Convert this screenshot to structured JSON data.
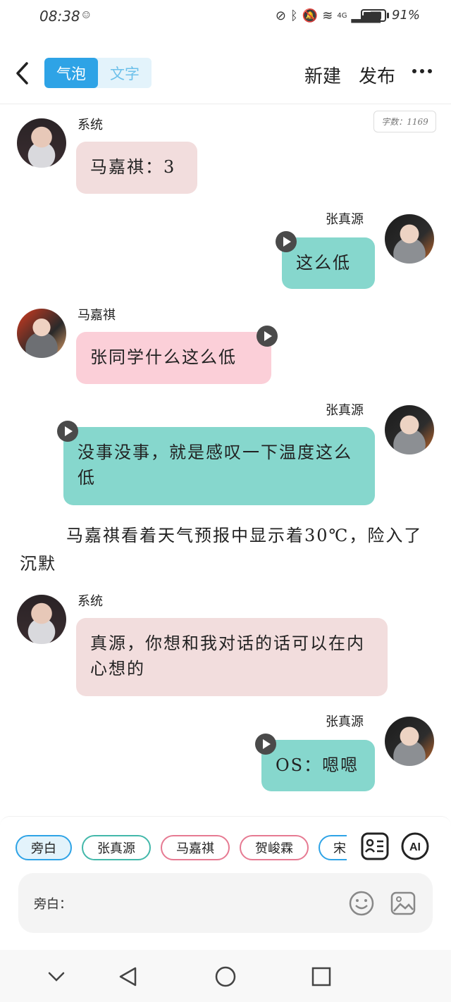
{
  "status_bar": {
    "time": "08:38",
    "indicator": "☺",
    "network": "4G",
    "battery_level": 0.91,
    "battery_text": "91%"
  },
  "header": {
    "tabs": [
      {
        "label": "气泡",
        "active": true
      },
      {
        "label": "文字",
        "active": false
      }
    ],
    "new_label": "新建",
    "publish_label": "发布"
  },
  "word_count": "字数：1169",
  "messages": [
    {
      "sender": "系统",
      "text": "马嘉祺：3",
      "side": "left",
      "style": "pink-gray",
      "has_voice": false
    },
    {
      "sender": "张真源",
      "text": "这么低",
      "side": "right",
      "style": "teal",
      "has_voice": true
    },
    {
      "sender": "马嘉祺",
      "text": "张同学什么这么低",
      "side": "left",
      "style": "pink",
      "has_voice": true
    },
    {
      "sender": "张真源",
      "text": "没事没事，就是感叹一下温度这么低",
      "side": "right",
      "style": "teal",
      "has_voice": true
    },
    {
      "sender": "系统",
      "text": "真源，你想和我对话的话可以在内心想的",
      "side": "left",
      "style": "pink-gray",
      "has_voice": false
    },
    {
      "sender": "张真源",
      "text": "OS：嗯嗯",
      "side": "right",
      "style": "teal",
      "has_voice": true
    }
  ],
  "narration": "马嘉祺看着天气预报中显示着30℃，险入了沉默",
  "compose": {
    "chips": [
      "旁白",
      "张真源",
      "马嘉祺",
      "贺峻霖",
      "宋"
    ],
    "input_label": "旁白：",
    "input_value": ""
  },
  "colors": {
    "accent": "#2ea3e6",
    "teal_bubble": "#86d7cd",
    "pink_bubble": "#fbcfd8",
    "system_bubble": "#f2dddd"
  }
}
